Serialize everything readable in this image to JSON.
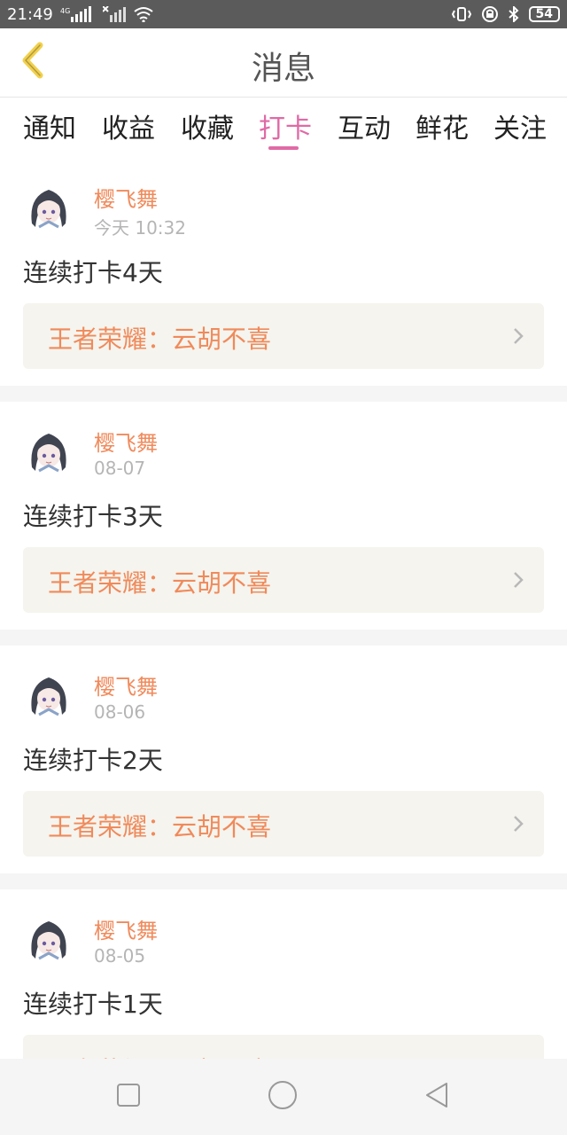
{
  "status_bar": {
    "time": "21:49",
    "network": "4G",
    "battery": "54"
  },
  "header": {
    "title": "消息"
  },
  "tabs": [
    {
      "label": "通知"
    },
    {
      "label": "收益"
    },
    {
      "label": "收藏"
    },
    {
      "label": "打卡",
      "active": true
    },
    {
      "label": "互动"
    },
    {
      "label": "鲜花"
    },
    {
      "label": "关注"
    }
  ],
  "feed": {
    "items": [
      {
        "user": "樱飞舞",
        "time": "今天 10:32",
        "text": "连续打卡4天",
        "link": "王者荣耀：云胡不喜"
      },
      {
        "user": "樱飞舞",
        "time": "08-07",
        "text": "连续打卡3天",
        "link": "王者荣耀：云胡不喜"
      },
      {
        "user": "樱飞舞",
        "time": "08-06",
        "text": "连续打卡2天",
        "link": "王者荣耀：云胡不喜"
      },
      {
        "user": "樱飞舞",
        "time": "08-05",
        "text": "连续打卡1天",
        "link": "王者荣耀：云胡不喜"
      }
    ]
  },
  "colors": {
    "accent": "#e06aa6",
    "username": "#f08a5b",
    "link": "#f08a5b",
    "back_icon": "#f2d04a"
  },
  "nav_bar": {
    "buttons": [
      "square-icon",
      "circle-icon",
      "triangle-back-icon"
    ]
  }
}
